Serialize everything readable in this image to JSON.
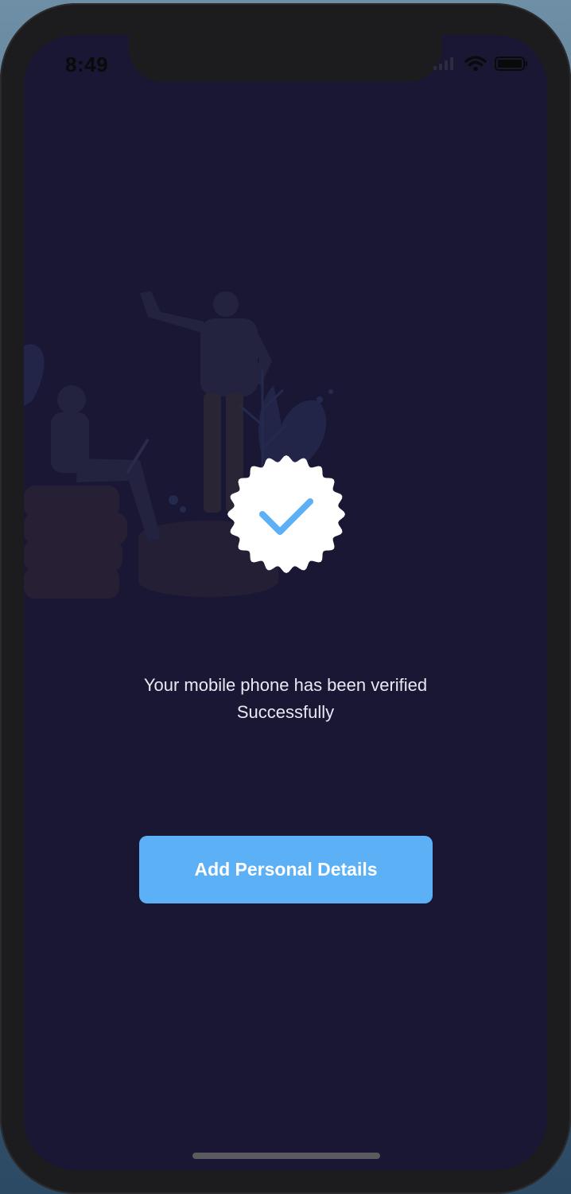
{
  "status_bar": {
    "time": "8:49",
    "icons": [
      "signal-icon",
      "wifi-icon",
      "battery-icon"
    ]
  },
  "illustration": {
    "icon": "people-on-coins-illustration"
  },
  "badge": {
    "icon": "verified-check-badge-icon"
  },
  "message": {
    "line1": "Your mobile phone has been verified",
    "line2": "Successfully"
  },
  "button": {
    "label": "Add Personal Details"
  },
  "colors": {
    "screen_background": "#191734",
    "accent": "#5cb0f5",
    "badge_fill": "#ffffff",
    "text": "#e9e8f2"
  }
}
